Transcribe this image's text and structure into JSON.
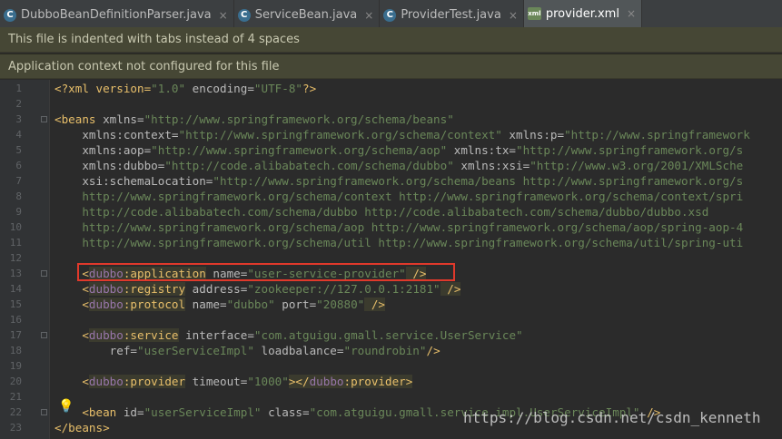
{
  "tabs": [
    {
      "label": "DubboBeanDefinitionParser.java",
      "icon": "C",
      "active": false
    },
    {
      "label": "ServiceBean.java",
      "icon": "C",
      "active": false
    },
    {
      "label": "ProviderTest.java",
      "icon": "C",
      "active": false
    },
    {
      "label": "provider.xml",
      "icon": "xml",
      "active": true
    }
  ],
  "close_glyph": "×",
  "banners": {
    "indent": "This file is indented with tabs instead of 4 spaces",
    "context": "Application context not configured for this file"
  },
  "line_numbers": [
    "1",
    "2",
    "3",
    "4",
    "5",
    "6",
    "7",
    "8",
    "9",
    "10",
    "11",
    "12",
    "13",
    "14",
    "15",
    "16",
    "17",
    "18",
    "19",
    "20",
    "21",
    "22",
    "23"
  ],
  "code": {
    "l1": [
      "<?xml version=",
      "\"1.0\"",
      " encoding=",
      "\"UTF-8\"",
      "?>"
    ],
    "l3": [
      "<beans",
      " xmlns=",
      "\"http://www.springframework.org/schema/beans\""
    ],
    "l4": [
      "    xmlns:context=",
      "\"http://www.springframework.org/schema/context\"",
      " xmlns:p=",
      "\"http://www.springframework"
    ],
    "l5": [
      "    xmlns:aop=",
      "\"http://www.springframework.org/schema/aop\"",
      " xmlns:tx=",
      "\"http://www.springframework.org/s"
    ],
    "l6": [
      "    xmlns:dubbo=",
      "\"http://code.alibabatech.com/schema/dubbo\"",
      " xmlns:xsi=",
      "\"http://www.w3.org/2001/XMLSche"
    ],
    "l7": [
      "    xsi:schemaLocation=",
      "\"http://www.springframework.org/schema/beans http://www.springframework.org/s"
    ],
    "l8": [
      "    http://www.springframework.org/schema/context http://www.springframework.org/schema/context/spri"
    ],
    "l9": [
      "    http://code.alibabatech.com/schema/dubbo http://code.alibabatech.com/schema/dubbo/dubbo.xsd"
    ],
    "l10": [
      "    http://www.springframework.org/schema/aop http://www.springframework.org/schema/aop/spring-aop-4"
    ],
    "l11": [
      "    http://www.springframework.org/schema/util http://www.springframework.org/schema/util/spring-uti"
    ],
    "l13": [
      "    <",
      "dubbo",
      ":application",
      " name=",
      "\"user-service-provider\"",
      " />"
    ],
    "l14": [
      "    <",
      "dubbo",
      ":registry",
      " address=",
      "\"zookeeper://127.0.0.1:2181\"",
      " />"
    ],
    "l15": [
      "    <",
      "dubbo",
      ":protocol",
      " name=",
      "\"dubbo\"",
      " port=",
      "\"20880\"",
      " />"
    ],
    "l17": [
      "    <",
      "dubbo",
      ":service",
      " interface=",
      "\"com.atguigu.gmall.service.UserService\""
    ],
    "l18": [
      "        ref=",
      "\"userServiceImpl\"",
      " loadbalance=",
      "\"roundrobin\"",
      "/>"
    ],
    "l20": [
      "    <",
      "dubbo",
      ":provider",
      " timeout=",
      "\"1000\"",
      "></",
      "dubbo",
      ":provider>"
    ],
    "l22": [
      "    <bean",
      " id=",
      "\"userServiceImpl\"",
      " class=",
      "\"com.atguigu.gmall.service.impl.UserServiceImpl\"",
      " />"
    ],
    "l23": [
      "</beans>"
    ]
  },
  "watermark": "https://blog.csdn.net/csdn_kenneth",
  "colors": {
    "tag": "#e8bf6a",
    "namespace": "#9876aa",
    "attribute": "#bababa",
    "value": "#6a8759",
    "highlight_box": "#e0392b"
  }
}
